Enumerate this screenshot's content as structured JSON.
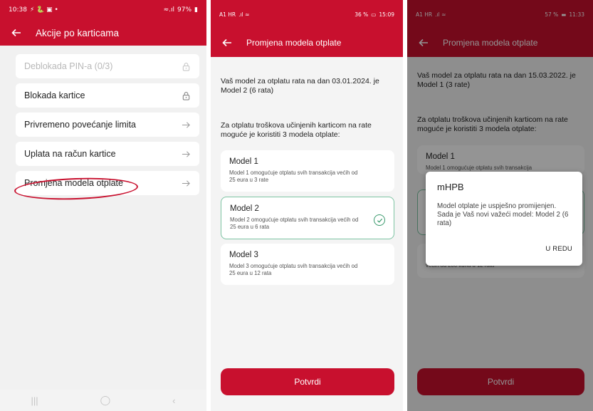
{
  "phone1": {
    "status": {
      "time": "10:38",
      "icons_left": "⚡ 🐍 ▣ •",
      "battery": "97%"
    },
    "title": "Akcije po karticama",
    "items": [
      {
        "label": "Deblokada PIN-a (0/3)",
        "icon": "lock-icon"
      },
      {
        "label": "Blokada kartice",
        "icon": "lock-icon"
      },
      {
        "label": "Privremeno povećanje limita",
        "icon": "arrow-right-icon"
      },
      {
        "label": "Uplata na račun kartice",
        "icon": "arrow-right-icon"
      },
      {
        "label": "Promjena modela otplate",
        "icon": "arrow-right-icon"
      }
    ],
    "nav": {
      "recent": "|||",
      "home": "◯",
      "back": "‹"
    }
  },
  "phone2": {
    "status": {
      "carrier": "A1 HR",
      "battery": "36 %",
      "time": "15:09"
    },
    "title": "Promjena modela otplate",
    "intro": "Vaš model za otplatu rata na dan 03.01.2024. je Model 2 (6 rata)",
    "intro2": "Za otplatu troškova učinjenih karticom na rate moguće je koristiti 3 modela otplate:",
    "models": [
      {
        "title": "Model 1",
        "desc": "Model 1 omogućuje otplatu svih transakcija većih od 25 eura u 3 rate"
      },
      {
        "title": "Model 2",
        "desc": "Model 2 omogućuje otplatu svih transakcija većih od 25 eura u 6 rata"
      },
      {
        "title": "Model 3",
        "desc": "Model 3 omogućuje otplatu svih transakcija većih od 25 eura u 12 rata"
      }
    ],
    "button": "Potvrdi"
  },
  "phone3": {
    "status": {
      "carrier": "A1 HR",
      "battery": "57 %",
      "time": "11:33"
    },
    "title": "Promjena modela otplate",
    "intro": "Vaš model za otplatu rata na dan 15.03.2022. je Model 1 (3 rate)",
    "intro2": "Za otplatu troškova učinjenih karticom na rate moguće je koristiti 3 modela otplate:",
    "model1_title": "Model 1",
    "model1_desc": "Model 1 omogućuje otplatu svih transakcija",
    "model3_desc": "većih od 200 kuna u 12 rata",
    "button": "Potvrdi",
    "dialog": {
      "title": "mHPB",
      "message": "Model otplate je uspješno promijenjen. Sada je Vaš novi važeći model: Model 2 (6 rata)",
      "ok": "U REDU"
    }
  }
}
